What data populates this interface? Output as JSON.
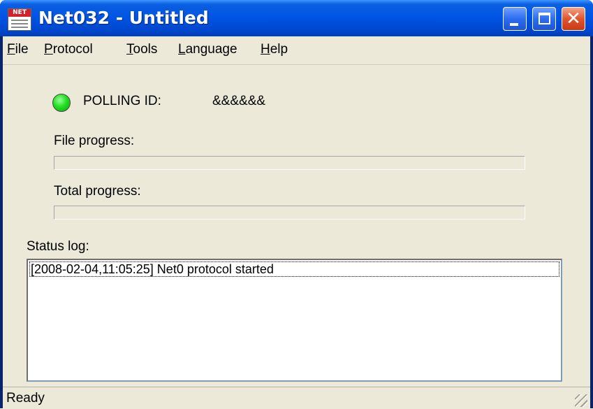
{
  "window": {
    "title": "Net032 - Untitled",
    "icon": "net-app-icon",
    "icon_text": "NET",
    "controls": [
      "minimize-icon",
      "maximize-icon",
      "close-icon"
    ]
  },
  "menu": {
    "items": [
      {
        "label": "File",
        "mnemonic": "F"
      },
      {
        "label": "Protocol",
        "mnemonic": "P"
      },
      {
        "label": "Tools",
        "mnemonic": "T"
      },
      {
        "label": "Language",
        "mnemonic": "L"
      },
      {
        "label": "Help",
        "mnemonic": "H"
      }
    ]
  },
  "polling": {
    "status_color": "#22e022",
    "label": "POLLING ID:",
    "value": "&&&&&&"
  },
  "file_progress": {
    "label": "File progress:",
    "value": 0
  },
  "total_progress": {
    "label": "Total progress:",
    "value": 0
  },
  "status_log": {
    "label": "Status log:",
    "entries": [
      "[2008-02-04,11:05:25]  Net0 protocol started"
    ]
  },
  "statusbar": {
    "text": "Ready"
  }
}
